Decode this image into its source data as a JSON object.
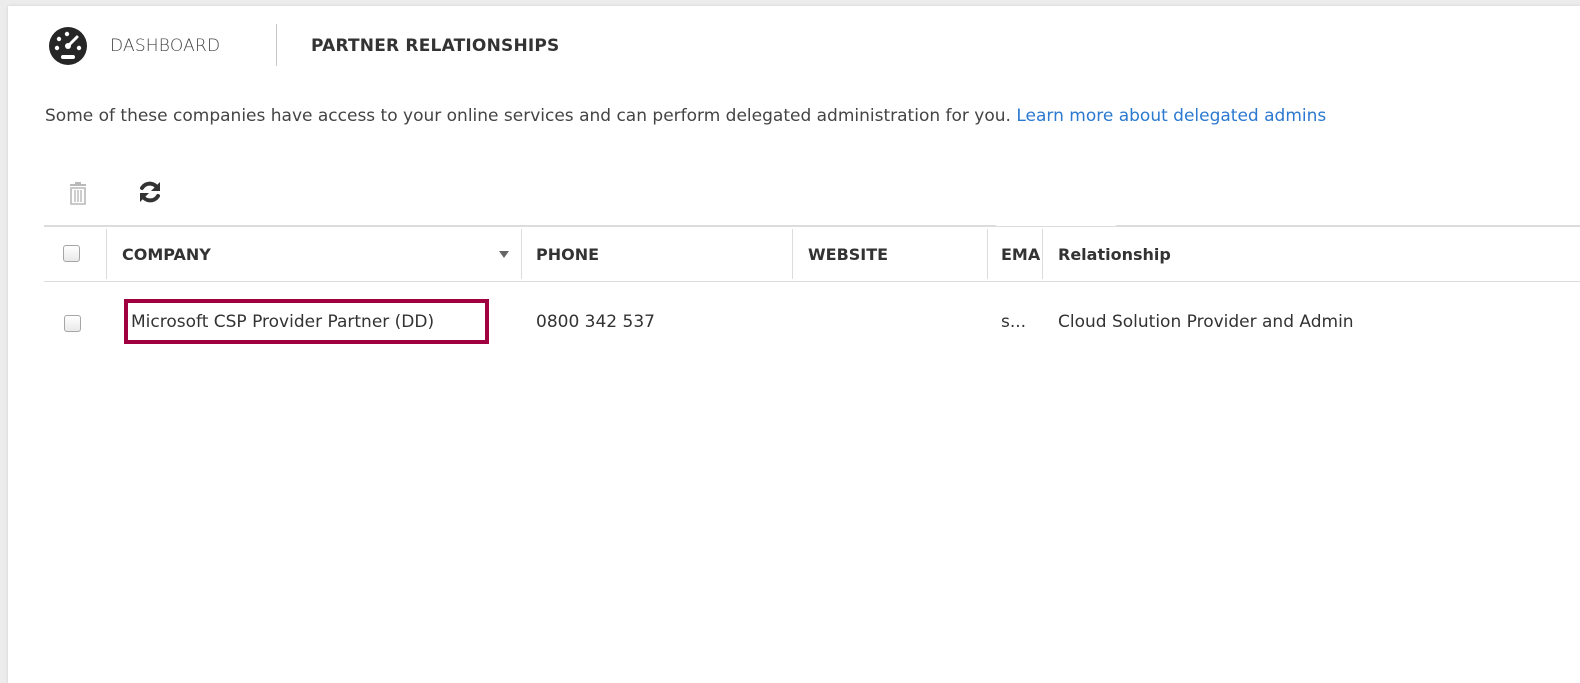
{
  "header": {
    "dashboard_label": "DASHBOARD",
    "page_title": "PARTNER RELATIONSHIPS"
  },
  "description": {
    "text": "Some of these companies have access to your online services and can perform delegated administration for you.",
    "link_text": "Learn more about delegated admins"
  },
  "toolbar": {
    "delete_icon": "trash-icon",
    "refresh_icon": "refresh-icon"
  },
  "table": {
    "columns": [
      "COMPANY",
      "PHONE",
      "WEBSITE",
      "EMA",
      "Relationship"
    ],
    "rows": [
      {
        "company": "Microsoft CSP Provider Partner (DD)",
        "phone": "0800 342 537",
        "website": "",
        "email": "s...",
        "relationship": "Cloud Solution Provider and Admin"
      }
    ]
  },
  "colors": {
    "link": "#2b79d0",
    "highlight": "#a00040"
  }
}
